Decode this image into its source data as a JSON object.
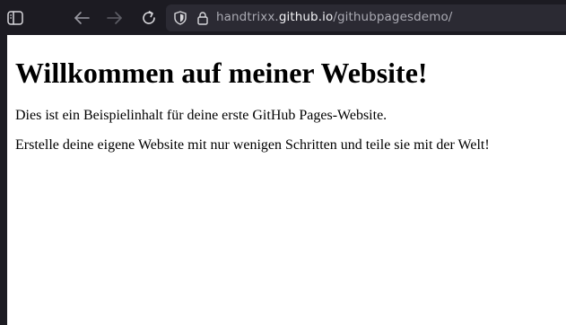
{
  "browser": {
    "url": {
      "prefix": "handtrixx.",
      "host": "github.io",
      "path": "/githubpagesdemo/"
    },
    "icons": {
      "sidebar": "sidebar-toggle-icon",
      "back": "back-arrow-icon",
      "forward": "forward-arrow-icon",
      "reload": "reload-icon",
      "shield": "tracking-protection-shield-icon",
      "lock": "lock-icon"
    },
    "colors": {
      "toolbar_bg": "#1c1b22",
      "page_bg": "#ffffff",
      "url_host": "#f2f2f5",
      "url_muted": "#a9a9b2"
    }
  },
  "page": {
    "heading": "Willkommen auf meiner Website!",
    "paragraphs": [
      "Dies ist ein Beispielinhalt für deine erste GitHub Pages-Website.",
      "Erstelle deine eigene Website mit nur wenigen Schritten und teile sie mit der Welt!"
    ]
  }
}
